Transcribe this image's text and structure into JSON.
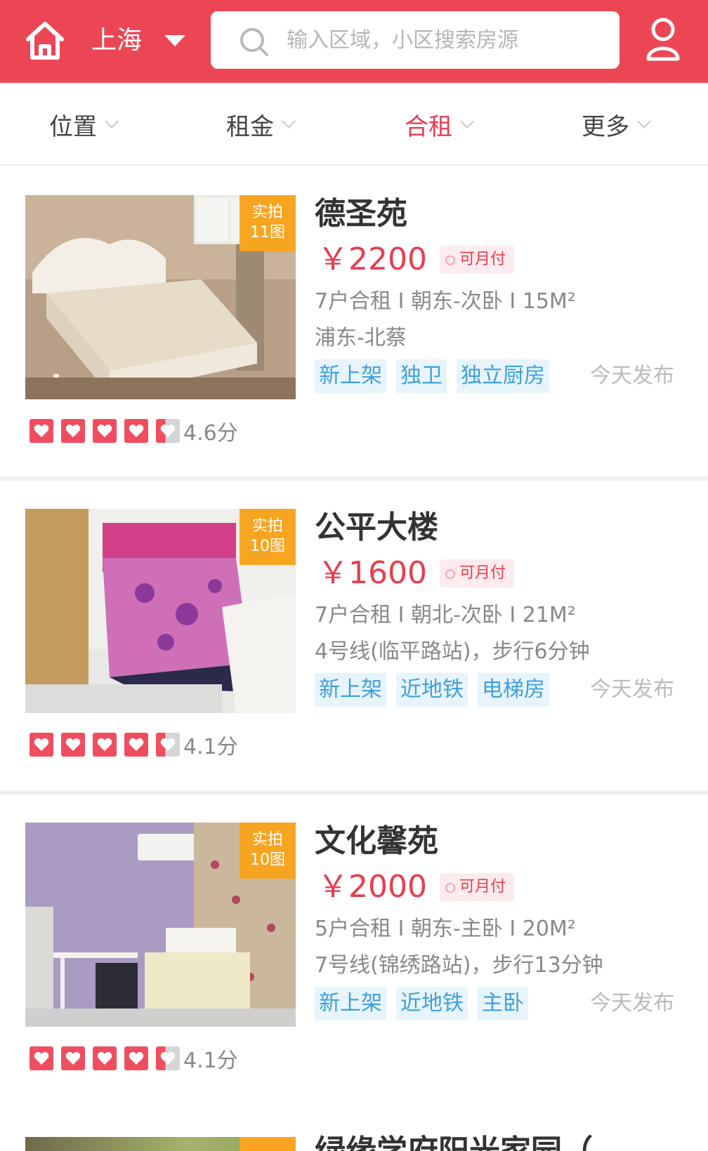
{
  "header": {
    "city": "上海",
    "search_placeholder": "输入区域，小区搜索房源"
  },
  "filters": [
    {
      "label": "位置",
      "active": false
    },
    {
      "label": "租金",
      "active": false
    },
    {
      "label": "合租",
      "active": true
    },
    {
      "label": "更多",
      "active": false
    }
  ],
  "listings": [
    {
      "badge_line1": "实拍",
      "badge_line2": "11图",
      "title": "德圣苑",
      "price": "￥2200",
      "pay_tag": "可月付",
      "meta1": "7户合租 I 朝东-次卧 I 15M²",
      "meta2": "浦东-北蔡",
      "tags": [
        "新上架",
        "独卫",
        "独立厨房"
      ],
      "posted": "今天发布",
      "score": "4.6分"
    },
    {
      "badge_line1": "实拍",
      "badge_line2": "10图",
      "title": "公平大楼",
      "price": "￥1600",
      "pay_tag": "可月付",
      "meta1": "7户合租 I 朝北-次卧 I 21M²",
      "meta2": "4号线(临平路站)，步行6分钟",
      "tags": [
        "新上架",
        "近地铁",
        "电梯房"
      ],
      "posted": "今天发布",
      "score": "4.1分"
    },
    {
      "badge_line1": "实拍",
      "badge_line2": "10图",
      "title": "文化馨苑",
      "price": "￥2000",
      "pay_tag": "可月付",
      "meta1": "5户合租 I 朝东-主卧 I 20M²",
      "meta2": "7号线(锦绣路站)，步行13分钟",
      "tags": [
        "新上架",
        "近地铁",
        "主卧"
      ],
      "posted": "今天发布",
      "score": "4.1分"
    }
  ],
  "peek_title": "绿缘学府阳光家园（",
  "colors": {
    "brand_red": "#ec4655",
    "price_red": "#e83e4f",
    "badge_orange": "#f7a521",
    "tag_blue": "#3ea0dc",
    "tag_bg": "#e8f4fb"
  }
}
